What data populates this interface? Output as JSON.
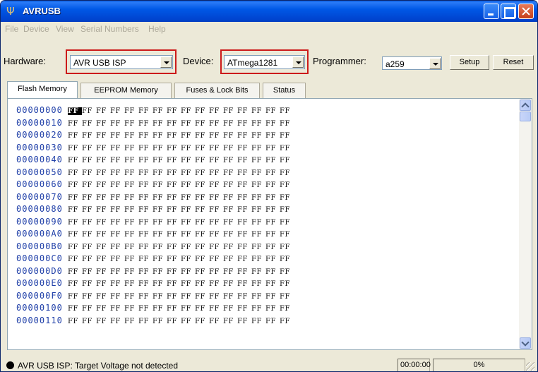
{
  "window": {
    "title": "AVRUSB"
  },
  "menu": [
    "File",
    "Device",
    "View",
    "Serial Numbers",
    "Help"
  ],
  "toolbar": {
    "hardware_label": "Hardware:",
    "hardware_value": "AVR USB ISP",
    "device_label": "Device:",
    "device_value": "ATmega1281",
    "programmer_label": "Programmer:",
    "programmer_value": "a259",
    "setup_label": "Setup",
    "reset_label": "Reset"
  },
  "tabs": [
    {
      "label": "Flash Memory",
      "active": true
    },
    {
      "label": "EEPROM Memory",
      "active": false
    },
    {
      "label": "Fuses & Lock Bits",
      "active": false
    },
    {
      "label": "Status",
      "active": false
    }
  ],
  "hex": {
    "selected_row": 0,
    "selected_col": 0,
    "rows": [
      {
        "addr": "00000000",
        "bytes": [
          "FF",
          "FF",
          "FF",
          "FF",
          "FF",
          "FF",
          "FF",
          "FF",
          "FF",
          "FF",
          "FF",
          "FF",
          "FF",
          "FF",
          "FF",
          "FF"
        ]
      },
      {
        "addr": "00000010",
        "bytes": [
          "FF",
          "FF",
          "FF",
          "FF",
          "FF",
          "FF",
          "FF",
          "FF",
          "FF",
          "FF",
          "FF",
          "FF",
          "FF",
          "FF",
          "FF",
          "FF"
        ]
      },
      {
        "addr": "00000020",
        "bytes": [
          "FF",
          "FF",
          "FF",
          "FF",
          "FF",
          "FF",
          "FF",
          "FF",
          "FF",
          "FF",
          "FF",
          "FF",
          "FF",
          "FF",
          "FF",
          "FF"
        ]
      },
      {
        "addr": "00000030",
        "bytes": [
          "FF",
          "FF",
          "FF",
          "FF",
          "FF",
          "FF",
          "FF",
          "FF",
          "FF",
          "FF",
          "FF",
          "FF",
          "FF",
          "FF",
          "FF",
          "FF"
        ]
      },
      {
        "addr": "00000040",
        "bytes": [
          "FF",
          "FF",
          "FF",
          "FF",
          "FF",
          "FF",
          "FF",
          "FF",
          "FF",
          "FF",
          "FF",
          "FF",
          "FF",
          "FF",
          "FF",
          "FF"
        ]
      },
      {
        "addr": "00000050",
        "bytes": [
          "FF",
          "FF",
          "FF",
          "FF",
          "FF",
          "FF",
          "FF",
          "FF",
          "FF",
          "FF",
          "FF",
          "FF",
          "FF",
          "FF",
          "FF",
          "FF"
        ]
      },
      {
        "addr": "00000060",
        "bytes": [
          "FF",
          "FF",
          "FF",
          "FF",
          "FF",
          "FF",
          "FF",
          "FF",
          "FF",
          "FF",
          "FF",
          "FF",
          "FF",
          "FF",
          "FF",
          "FF"
        ]
      },
      {
        "addr": "00000070",
        "bytes": [
          "FF",
          "FF",
          "FF",
          "FF",
          "FF",
          "FF",
          "FF",
          "FF",
          "FF",
          "FF",
          "FF",
          "FF",
          "FF",
          "FF",
          "FF",
          "FF"
        ]
      },
      {
        "addr": "00000080",
        "bytes": [
          "FF",
          "FF",
          "FF",
          "FF",
          "FF",
          "FF",
          "FF",
          "FF",
          "FF",
          "FF",
          "FF",
          "FF",
          "FF",
          "FF",
          "FF",
          "FF"
        ]
      },
      {
        "addr": "00000090",
        "bytes": [
          "FF",
          "FF",
          "FF",
          "FF",
          "FF",
          "FF",
          "FF",
          "FF",
          "FF",
          "FF",
          "FF",
          "FF",
          "FF",
          "FF",
          "FF",
          "FF"
        ]
      },
      {
        "addr": "000000A0",
        "bytes": [
          "FF",
          "FF",
          "FF",
          "FF",
          "FF",
          "FF",
          "FF",
          "FF",
          "FF",
          "FF",
          "FF",
          "FF",
          "FF",
          "FF",
          "FF",
          "FF"
        ]
      },
      {
        "addr": "000000B0",
        "bytes": [
          "FF",
          "FF",
          "FF",
          "FF",
          "FF",
          "FF",
          "FF",
          "FF",
          "FF",
          "FF",
          "FF",
          "FF",
          "FF",
          "FF",
          "FF",
          "FF"
        ]
      },
      {
        "addr": "000000C0",
        "bytes": [
          "FF",
          "FF",
          "FF",
          "FF",
          "FF",
          "FF",
          "FF",
          "FF",
          "FF",
          "FF",
          "FF",
          "FF",
          "FF",
          "FF",
          "FF",
          "FF"
        ]
      },
      {
        "addr": "000000D0",
        "bytes": [
          "FF",
          "FF",
          "FF",
          "FF",
          "FF",
          "FF",
          "FF",
          "FF",
          "FF",
          "FF",
          "FF",
          "FF",
          "FF",
          "FF",
          "FF",
          "FF"
        ]
      },
      {
        "addr": "000000E0",
        "bytes": [
          "FF",
          "FF",
          "FF",
          "FF",
          "FF",
          "FF",
          "FF",
          "FF",
          "FF",
          "FF",
          "FF",
          "FF",
          "FF",
          "FF",
          "FF",
          "FF"
        ]
      },
      {
        "addr": "000000F0",
        "bytes": [
          "FF",
          "FF",
          "FF",
          "FF",
          "FF",
          "FF",
          "FF",
          "FF",
          "FF",
          "FF",
          "FF",
          "FF",
          "FF",
          "FF",
          "FF",
          "FF"
        ]
      },
      {
        "addr": "00000100",
        "bytes": [
          "FF",
          "FF",
          "FF",
          "FF",
          "FF",
          "FF",
          "FF",
          "FF",
          "FF",
          "FF",
          "FF",
          "FF",
          "FF",
          "FF",
          "FF",
          "FF"
        ]
      },
      {
        "addr": "00000110",
        "bytes": [
          "FF",
          "FF",
          "FF",
          "FF",
          "FF",
          "FF",
          "FF",
          "FF",
          "FF",
          "FF",
          "FF",
          "FF",
          "FF",
          "FF",
          "FF",
          "FF"
        ]
      }
    ]
  },
  "status": {
    "message": "AVR USB ISP: Target Voltage not detected",
    "time": "00:00:00",
    "progress": "0%",
    "progress_fraction": 0
  },
  "colors": {
    "titlebar": "#0054e3",
    "highlight_box": "#cc1a1a",
    "address_text": "#1f3fa8"
  }
}
